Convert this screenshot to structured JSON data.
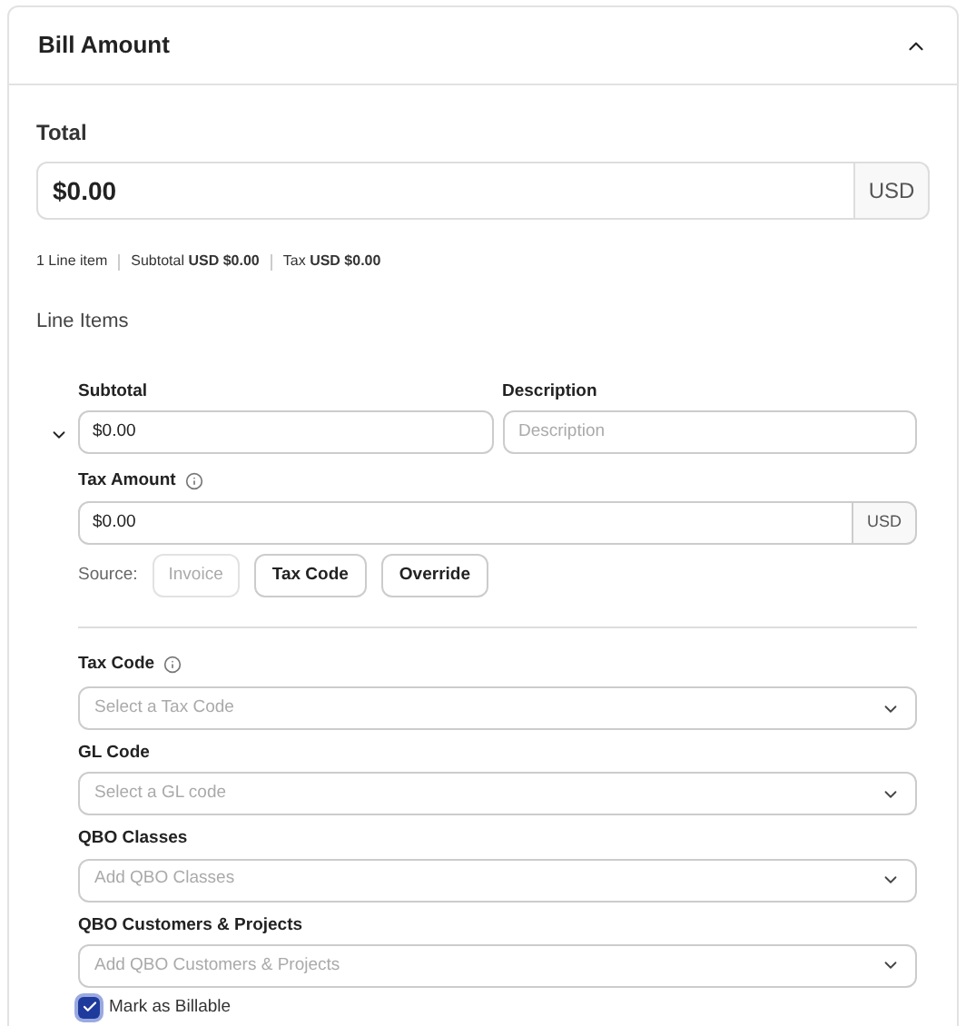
{
  "section": {
    "title": "Bill Amount",
    "expanded": true
  },
  "total": {
    "label": "Total",
    "value": "$0.00",
    "currency": "USD"
  },
  "summary": [
    {
      "kind": "plain",
      "text": "1 Line item"
    },
    {
      "kind": "pair",
      "label": "Subtotal",
      "value": "USD $0.00"
    },
    {
      "kind": "pair",
      "label": "Tax",
      "value": "USD $0.00"
    }
  ],
  "line_items_label": "Line Items",
  "line_item": {
    "expanded": true,
    "subtotal": {
      "label": "Subtotal",
      "value": "$0.00"
    },
    "description": {
      "label": "Description",
      "placeholder": "Description"
    },
    "tax_amount": {
      "label": "Tax Amount",
      "value": "$0.00",
      "currency": "USD"
    },
    "source_label": "Source:",
    "sources": [
      {
        "label": "Invoice",
        "disabled": true
      },
      {
        "label": "Tax Code",
        "disabled": false
      },
      {
        "label": "Override",
        "disabled": false
      }
    ],
    "selects": [
      {
        "label": "Tax Code",
        "info": true,
        "placeholder": "Select a Tax Code"
      },
      {
        "label": "GL Code",
        "info": false,
        "placeholder": "Select a GL code"
      },
      {
        "label": "QBO Classes",
        "info": false,
        "placeholder": "Add QBO Classes"
      },
      {
        "label": "QBO Customers & Projects",
        "info": false,
        "placeholder": "Add QBO Customers & Projects"
      }
    ],
    "billable": {
      "label": "Mark as Billable",
      "checked": true
    }
  }
}
